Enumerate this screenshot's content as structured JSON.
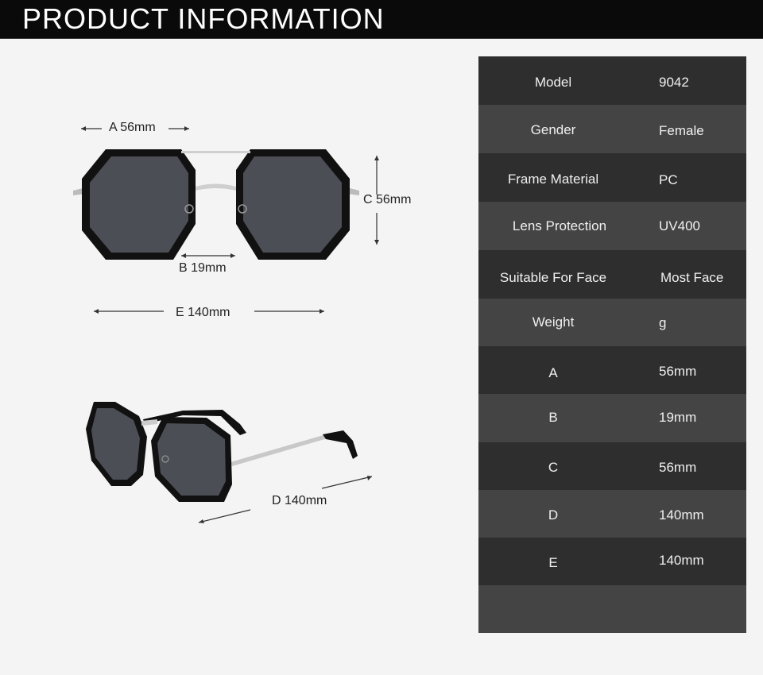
{
  "header": {
    "title": "PRODUCT INFORMATION"
  },
  "dimensions": {
    "a": "A 56mm",
    "b": "B 19mm",
    "c": "C 56mm",
    "d": "D 140mm",
    "e": "E 140mm"
  },
  "specs": [
    {
      "label": "Model",
      "value": "9042"
    },
    {
      "label": "Gender",
      "value": "Female"
    },
    {
      "label": "Frame Material",
      "value": "PC"
    },
    {
      "label": "Lens Protection",
      "value": "UV400"
    },
    {
      "label": "Suitable For Face",
      "value": "Most Face"
    },
    {
      "label": "Weight",
      "value": "g"
    },
    {
      "label": "A",
      "value": "56mm"
    },
    {
      "label": "B",
      "value": "19mm"
    },
    {
      "label": "C",
      "value": "56mm"
    },
    {
      "label": "D",
      "value": "140mm"
    },
    {
      "label": "E",
      "value": "140mm"
    },
    {
      "label": "",
      "value": ""
    }
  ],
  "colors": {
    "header_bg": "#0a0a0a",
    "table_dark": "#2e2e2e",
    "table_light": "#444444",
    "frame": "#111111",
    "lens": "#4b4e55"
  }
}
